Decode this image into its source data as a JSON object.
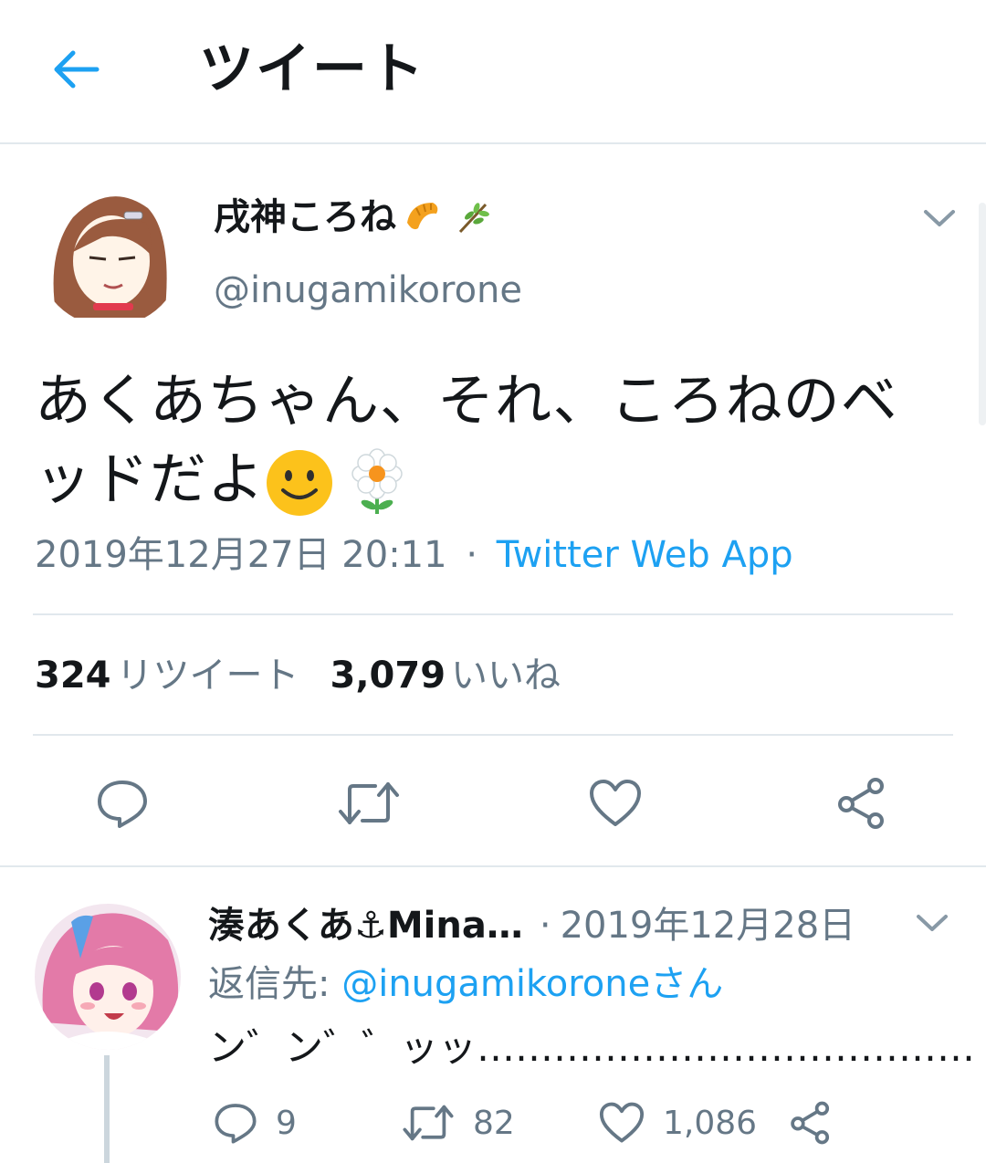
{
  "header": {
    "title": "ツイート"
  },
  "tweet": {
    "display_name": "戌神ころね",
    "handle": "@inugamikorone",
    "text_line1": "あくあちゃん、それ、ころねのベ",
    "text_line2": "ッドだよ",
    "timestamp": "2019年12月27日 20:11",
    "separator": "·",
    "source": "Twitter Web App",
    "retweet_count": "324",
    "retweet_label": "リツイート",
    "like_count": "3,079",
    "like_label": "いいね"
  },
  "reply": {
    "display_name": "湊あくあ⚓Mina…",
    "separator": "·",
    "date": "2019年12月28日",
    "reply_to_prefix": "返信先: ",
    "reply_to_handle": "@inugamikorone",
    "reply_to_suffix": "さん",
    "text": "ン゛ン゛゛ッッ…………………………………",
    "reply_count": "9",
    "retweet_count": "82",
    "like_count": "1,086"
  },
  "colors": {
    "accent": "#1da1f2",
    "secondary_text": "#657786",
    "divider": "#e1e8ed"
  },
  "icons": [
    "back-arrow-icon",
    "chevron-down-icon",
    "croissant-emoji",
    "herb-emoji",
    "smiley-emoji",
    "flower-emoji",
    "reply-icon",
    "retweet-icon",
    "like-icon",
    "share-icon"
  ]
}
